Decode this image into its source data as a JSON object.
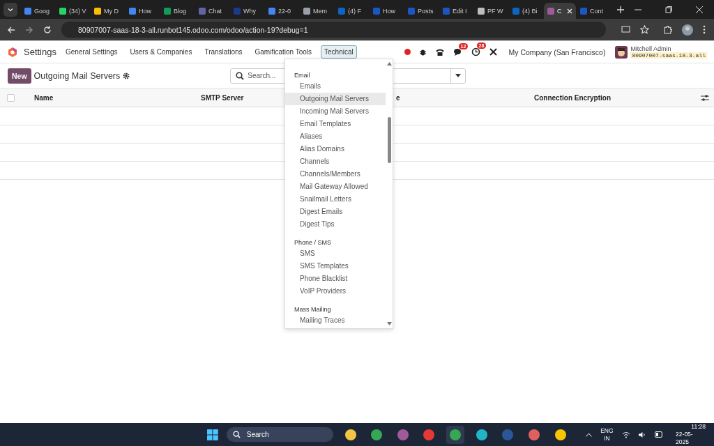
{
  "browser": {
    "tabs": [
      {
        "title": "Goog",
        "selected": false,
        "color": "#4285f4"
      },
      {
        "title": "(34) V",
        "selected": false,
        "color": "#25d366"
      },
      {
        "title": "My D",
        "selected": false,
        "color": "#fbbc04"
      },
      {
        "title": "How",
        "selected": false,
        "color": "#4285f4"
      },
      {
        "title": "Blog",
        "selected": false,
        "color": "#0f9d58"
      },
      {
        "title": "Chat",
        "selected": false,
        "color": "#6264a7"
      },
      {
        "title": "Why",
        "selected": false,
        "color": "#1a3a8a"
      },
      {
        "title": "22-0",
        "selected": false,
        "color": "#4285f4"
      },
      {
        "title": "Mem",
        "selected": false,
        "color": "#9aa0a6"
      },
      {
        "title": "(4) F",
        "selected": false,
        "color": "#0a66c2"
      },
      {
        "title": "How",
        "selected": false,
        "color": "#1a56c4"
      },
      {
        "title": "Posts",
        "selected": false,
        "color": "#1a56c4"
      },
      {
        "title": "Edit I",
        "selected": false,
        "color": "#1a56c4"
      },
      {
        "title": "PF W",
        "selected": false,
        "color": "#bdbdbd"
      },
      {
        "title": "(4) Bi",
        "selected": false,
        "color": "#0a66c2"
      },
      {
        "title": "C",
        "selected": true,
        "color": "#a05a9c"
      },
      {
        "title": "Cont",
        "selected": false,
        "color": "#1a56c4"
      }
    ],
    "url": "80907007-saas-18-3-all.runbot145.odoo.com/odoo/action-19?debug=1"
  },
  "navbar": {
    "app": "Settings",
    "menu": [
      {
        "label": "General Settings",
        "selected": false
      },
      {
        "label": "Users & Companies",
        "selected": false
      },
      {
        "label": "Translations",
        "selected": false
      },
      {
        "label": "Gamification Tools",
        "selected": false
      },
      {
        "label": "Technical",
        "selected": true
      }
    ],
    "messages_badge": "12",
    "activities_badge": "28",
    "company": "My Company (San Francisco)",
    "user": "Mitchell Admin",
    "database": "80907007-saas-18-3-all"
  },
  "control_panel": {
    "new_button": "New",
    "title": "Outgoing Mail Servers",
    "search": {
      "placeholder": "Search..."
    }
  },
  "table": {
    "select_all_checked": false,
    "columns": [
      "Name",
      "SMTP Server",
      "e",
      "Connection Encryption"
    ]
  },
  "dropdown": {
    "sections": [
      {
        "heading": "Email",
        "items": [
          {
            "label": "Emails",
            "selected": false
          },
          {
            "label": "Outgoing Mail Servers",
            "selected": true
          },
          {
            "label": "Incoming Mail Servers",
            "selected": false
          },
          {
            "label": "Email Templates",
            "selected": false
          },
          {
            "label": "Aliases",
            "selected": false
          },
          {
            "label": "Alias Domains",
            "selected": false
          },
          {
            "label": "Channels",
            "selected": false
          },
          {
            "label": "Channels/Members",
            "selected": false
          },
          {
            "label": "Mail Gateway Allowed",
            "selected": false
          },
          {
            "label": "Snailmail Letters",
            "selected": false
          },
          {
            "label": "Digest Emails",
            "selected": false
          },
          {
            "label": "Digest Tips",
            "selected": false
          }
        ]
      },
      {
        "heading": "Phone / SMS",
        "items": [
          {
            "label": "SMS",
            "selected": false
          },
          {
            "label": "SMS Templates",
            "selected": false
          },
          {
            "label": "Phone Blacklist",
            "selected": false
          },
          {
            "label": "VoIP Providers",
            "selected": false
          }
        ]
      },
      {
        "heading": "Mass Mailing",
        "items": [
          {
            "label": "Mailing Traces",
            "selected": false
          }
        ]
      }
    ]
  },
  "taskbar": {
    "search": {
      "placeholder": "Search"
    },
    "apps": [
      {
        "selected": false,
        "color": "#f4c542"
      },
      {
        "selected": false,
        "color": "#34a853"
      },
      {
        "selected": false,
        "color": "#a05a9c"
      },
      {
        "selected": false,
        "color": "#e53935"
      },
      {
        "selected": true,
        "color": "#34a853"
      },
      {
        "selected": false,
        "color": "#1fb6c9"
      },
      {
        "selected": false,
        "color": "#2b579a"
      },
      {
        "selected": false,
        "color": "#e06060"
      },
      {
        "selected": false,
        "color": "#f7c600"
      }
    ],
    "language": "ENG",
    "region": "IN",
    "time": "11:28",
    "date": "22-05-2025"
  }
}
